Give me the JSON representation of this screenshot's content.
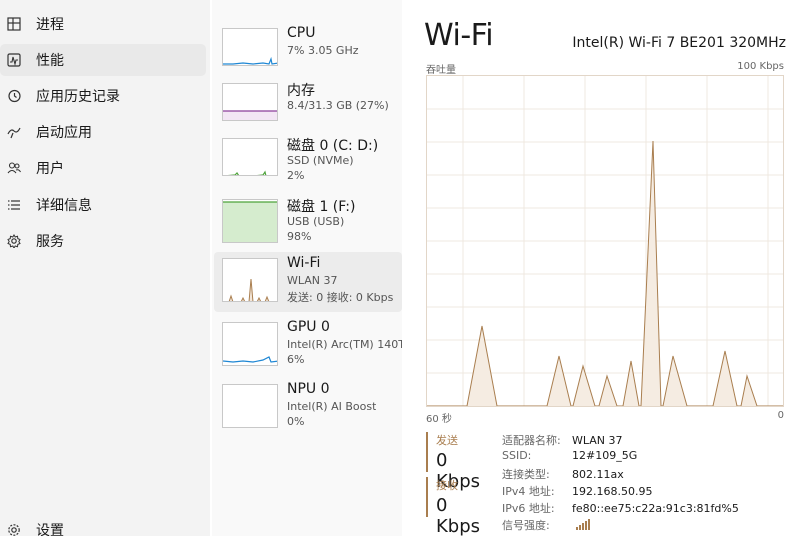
{
  "nav": {
    "items": [
      {
        "label": "进程",
        "icon": "processes-icon"
      },
      {
        "label": "性能",
        "icon": "performance-icon"
      },
      {
        "label": "应用历史记录",
        "icon": "history-icon"
      },
      {
        "label": "启动应用",
        "icon": "startup-icon"
      },
      {
        "label": "用户",
        "icon": "users-icon"
      },
      {
        "label": "详细信息",
        "icon": "details-icon"
      },
      {
        "label": "服务",
        "icon": "services-icon"
      }
    ],
    "settings_label": "设置",
    "active_index": 1
  },
  "resources": [
    {
      "name": "CPU",
      "line1": "7%  3.05 GHz",
      "line2": "",
      "color": "#1f87d4"
    },
    {
      "name": "内存",
      "line1": "8.4/31.3 GB (27%)",
      "line2": "",
      "color": "#8b3e9a"
    },
    {
      "name": "磁盘 0 (C: D:)",
      "line1": "SSD (NVMe)",
      "line2": "2%",
      "color": "#4ea33b"
    },
    {
      "name": "磁盘 1 (F:)",
      "line1": "USB (USB)",
      "line2": "98%",
      "color": "#4ea33b"
    },
    {
      "name": "Wi-Fi",
      "line1": "WLAN 37",
      "line2": "发送: 0  接收: 0 Kbps",
      "color": "#a97e4f"
    },
    {
      "name": "GPU 0",
      "line1": "Intel(R) Arc(TM) 140T...",
      "line2": "6%",
      "color": "#1f87d4"
    },
    {
      "name": "NPU 0",
      "line1": "Intel(R) AI Boost",
      "line2": "0%",
      "color": "#1f87d4"
    }
  ],
  "detail": {
    "title": "Wi-Fi",
    "adapter": "Intel(R) Wi-Fi 7 BE201 320MHz",
    "graph_label": "吞吐量",
    "graph_max": "100 Kbps",
    "graph_time": "60 秒",
    "graph_min": "0",
    "send_label": "发送",
    "send_value": "0 Kbps",
    "recv_label": "接收",
    "recv_value": "0 Kbps",
    "info": [
      {
        "k": "适配器名称:",
        "v": "WLAN 37"
      },
      {
        "k": "SSID:",
        "v": "12#109_5G"
      },
      {
        "k": "连接类型:",
        "v": "802.11ax"
      },
      {
        "k": "IPv4 地址:",
        "v": "192.168.50.95"
      },
      {
        "k": "IPv6 地址:",
        "v": "fe80::ee75:c22a:91c3:81fd%5"
      },
      {
        "k": "信号强度:",
        "v": ""
      }
    ],
    "accent": "#a97e4f"
  }
}
